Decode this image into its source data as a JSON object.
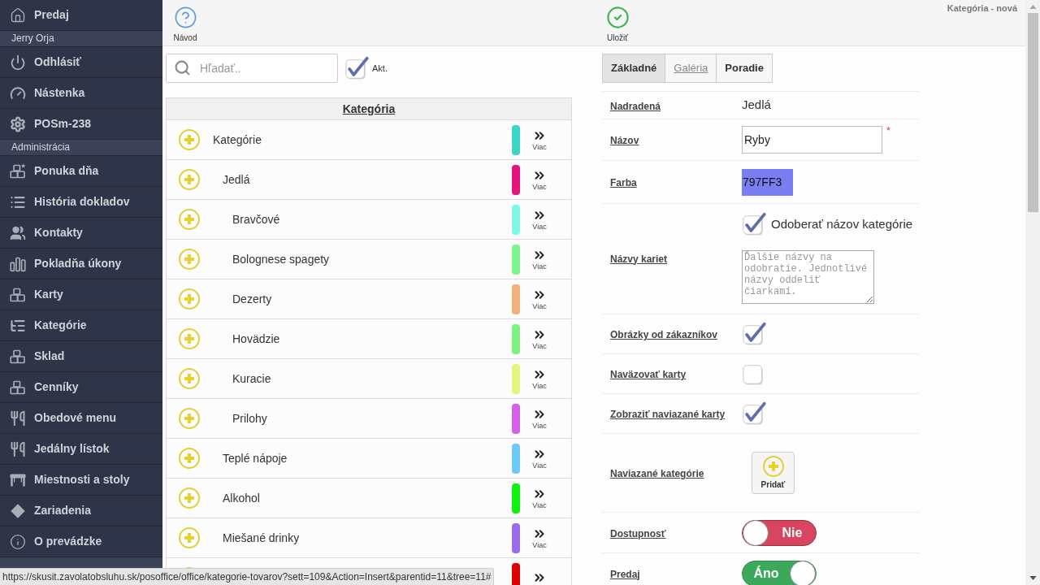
{
  "sidebar": {
    "items": [
      {
        "kind": "link",
        "label": "Predaj"
      },
      {
        "kind": "section",
        "label": "Jerry Orja"
      },
      {
        "kind": "link",
        "label": "Odhlásiť"
      },
      {
        "kind": "link",
        "label": "Nástenka"
      },
      {
        "kind": "link",
        "label": "POSm-238"
      },
      {
        "kind": "section",
        "label": "Administrácia"
      },
      {
        "kind": "link",
        "label": "Ponuka dňa"
      },
      {
        "kind": "link",
        "label": "História dokladov"
      },
      {
        "kind": "link",
        "label": "Kontakty"
      },
      {
        "kind": "link",
        "label": "Pokladňa úkony"
      },
      {
        "kind": "link",
        "label": "Karty"
      },
      {
        "kind": "link",
        "label": "Kategórie"
      },
      {
        "kind": "link",
        "label": "Sklad"
      },
      {
        "kind": "link",
        "label": "Cenníky"
      },
      {
        "kind": "link",
        "label": "Obedové menu"
      },
      {
        "kind": "link",
        "label": "Jedálny lístok"
      },
      {
        "kind": "link",
        "label": "Miestnosti a stoly"
      },
      {
        "kind": "link",
        "label": "Zariadenia"
      },
      {
        "kind": "link",
        "label": "O prevádzke"
      },
      {
        "kind": "section"
      }
    ]
  },
  "toolbar": {
    "buttons": [
      {
        "label": "Návod"
      },
      {
        "label": "Uložiť"
      }
    ],
    "title": "Kategória - nová"
  },
  "search": {
    "placeholder": "Hľadať.."
  },
  "active_filter": {
    "label": "Akt.",
    "checked": true
  },
  "category_table": {
    "column": "Kategória",
    "rows": [
      {
        "name": "Kategórie",
        "color": "#3ad5c5",
        "more": "Viac",
        "children": [
          {
            "name": "Jedlá",
            "color": "#e5147f",
            "more": "Viac",
            "children": [
              {
                "name": "Bravčové",
                "color": "#7ff7e6",
                "more": "Viac"
              },
              {
                "name": "Bolognese spagety",
                "color": "#7df58e",
                "more": "Viac"
              },
              {
                "name": "Dezerty",
                "color": "#f0b07a",
                "more": "Viac"
              },
              {
                "name": "Hovädzie",
                "color": "#80f080",
                "more": "Viac"
              },
              {
                "name": "Kuracie",
                "color": "#e6f57b",
                "more": "Viac"
              },
              {
                "name": "Prilohy",
                "color": "#d460e6",
                "more": "Viac"
              }
            ]
          },
          {
            "name": "Teplé nápoje",
            "color": "#6cc8f7",
            "more": "Viac"
          },
          {
            "name": "Alkohol",
            "color": "#0ff20f",
            "more": "Viac"
          },
          {
            "name": "Miešané drinky",
            "color": "#9c6be8",
            "more": "Viac"
          },
          {
            "color": "#e00000"
          }
        ]
      }
    ]
  },
  "tabs": [
    {
      "label": "Základné",
      "selected": true,
      "hovered": false
    },
    {
      "label": "Galéria",
      "selected": false,
      "hovered": true
    },
    {
      "label": "Poradie",
      "selected": false,
      "hovered": false
    }
  ],
  "form": {
    "rows": [
      {
        "kind": "text",
        "label": "Nadradená",
        "value": "Jedlá"
      },
      {
        "kind": "input",
        "label": "Názov",
        "value": "Ryby",
        "required_mark": "*"
      },
      {
        "kind": "color",
        "label": "Farba",
        "value": "797FF3",
        "color": "#797ff3"
      },
      {
        "kind": "names",
        "label": "Názvy kariet",
        "checkbox": {
          "label": "Odoberať názov kategórie",
          "checked": true
        },
        "placeholder": "Ďalšie názvy na odobratie. Jednotlivé názvy oddeliť čiarkami."
      },
      {
        "kind": "checkbox",
        "label": "Obrázky od zákazníkov",
        "checked": true
      },
      {
        "kind": "checkbox",
        "label": "Naväzovať karty",
        "checked": false
      },
      {
        "kind": "checkbox",
        "label": "Zobraziť naviazané karty",
        "checked": true
      },
      {
        "kind": "add",
        "label": "Naviazané kategórie",
        "button": "Pridať"
      },
      {
        "kind": "toggle",
        "label": "Dostupnosť",
        "on": false,
        "text": "Nie"
      },
      {
        "kind": "toggle",
        "label": "Predaj",
        "on": true,
        "text": "Áno"
      }
    ]
  },
  "status_url": "https://skusit.zavolatobsluhu.sk/posoffice/office/kategorie-tovarov?sett=109&Action=Insert&parentid=11&tree=11#"
}
